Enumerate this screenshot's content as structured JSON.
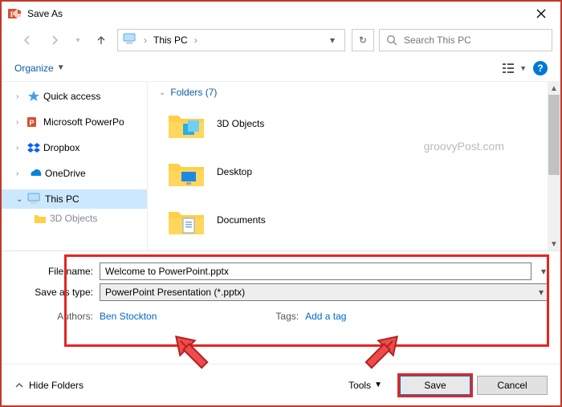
{
  "window": {
    "title": "Save As"
  },
  "nav": {
    "location": "This This PC",
    "location_label": "This PC",
    "dropdown_glyph": "▾",
    "refresh_glyph": "↻"
  },
  "search": {
    "placeholder": "Search This PC"
  },
  "toolbar": {
    "organize": "Organize"
  },
  "tree": {
    "quick_access": "Quick access",
    "powerpoint": "Microsoft PowerPo",
    "dropbox": "Dropbox",
    "onedrive": "OneDrive",
    "this_pc": "This PC",
    "three_d": "3D Objects"
  },
  "pane": {
    "folders_header": "Folders (7)",
    "items": [
      "3D Objects",
      "Desktop",
      "Documents"
    ],
    "watermark": "groovyPost.com"
  },
  "fields": {
    "filename_label": "File name:",
    "filename_value": "Welcome to PowerPoint.pptx",
    "type_label": "Save as type:",
    "type_value": "PowerPoint Presentation (*.pptx)",
    "authors_label": "Authors:",
    "authors_value": "Ben Stockton",
    "tags_label": "Tags:",
    "tags_value": "Add a tag"
  },
  "footer": {
    "hide_folders": "Hide Folders",
    "tools": "Tools",
    "save": "Save",
    "cancel": "Cancel"
  }
}
